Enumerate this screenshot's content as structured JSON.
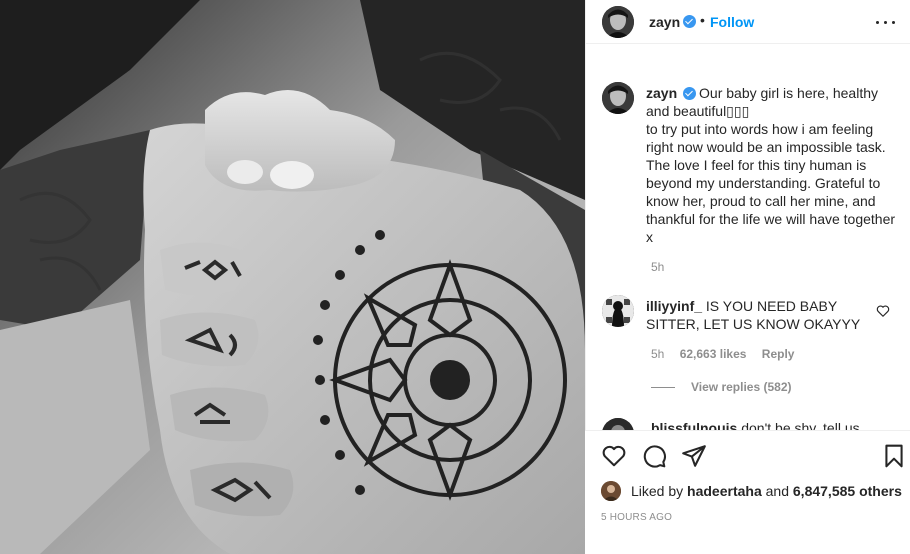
{
  "header": {
    "username": "zayn",
    "separator": "•",
    "follow_label": "Follow"
  },
  "caption": {
    "username": "zayn",
    "text": "Our baby girl is here, healthy and beautiful▯▯▯\nto try put into words how i am feeling right now would be an impossible task. The love I feel for this tiny human is beyond my understanding. Grateful to know her, proud to call her mine, and thankful for the life we will have together x",
    "time": "5h"
  },
  "comments": [
    {
      "username": "illiyyinf_",
      "text": "IS YOU NEED BABY SITTER, LET US KNOW OKAYYY",
      "time": "5h",
      "likes": "62,663 likes",
      "reply_label": "Reply",
      "view_replies": "View replies (582)"
    },
    {
      "username": "blissfulnouis",
      "text": "don't be shy, tell us"
    }
  ],
  "actions": {
    "like_icon": "heart-icon",
    "comment_icon": "comment-icon",
    "share_icon": "paper-plane-icon",
    "save_icon": "bookmark-icon"
  },
  "likes": {
    "prefix": "Liked by",
    "user": "hadeertaha",
    "middle": "and",
    "others": "6,847,585 others"
  },
  "posted_ago": "5 HOURS AGO",
  "colors": {
    "accent": "#0095f6",
    "verified": "#3897f0",
    "muted": "#8e8e8e",
    "text": "#262626"
  }
}
